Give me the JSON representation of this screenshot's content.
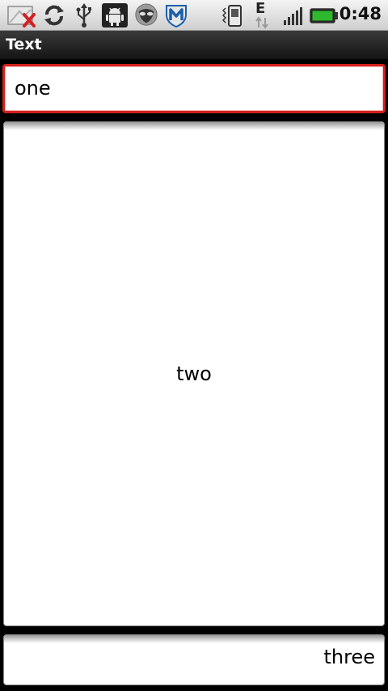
{
  "status_bar": {
    "time": "0:48",
    "network_type": "E",
    "icons": [
      "missed-notification-icon",
      "sync-icon",
      "usb-icon",
      "android-debug-icon",
      "alien-app-icon",
      "mcafee-shield-icon",
      "phone-vibrate-icon",
      "data-arrows-icon",
      "signal-bars-icon",
      "battery-icon"
    ],
    "battery_color": "#2db82d"
  },
  "title_bar": {
    "title": "Text"
  },
  "fields": {
    "one": "one",
    "two": "two",
    "three": "three"
  },
  "colors": {
    "focus_border": "#d4201c",
    "field_bg": "#ffffff",
    "background": "#000000"
  }
}
